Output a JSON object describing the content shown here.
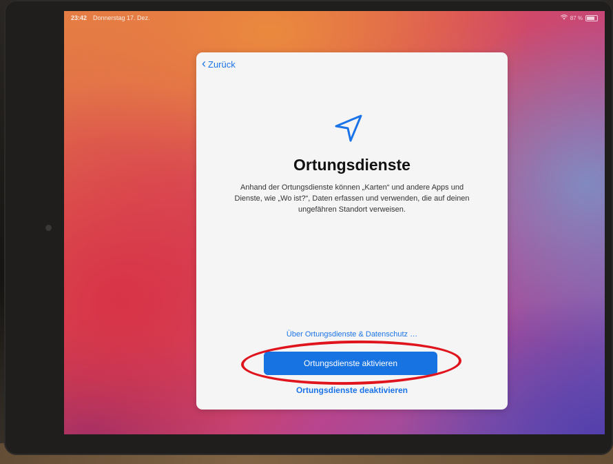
{
  "status_bar": {
    "time": "23:42",
    "date": "Donnerstag 17. Dez.",
    "battery": "87 %"
  },
  "sheet": {
    "back_label": "Zurück",
    "icon": "location-arrow-icon",
    "title": "Ortungsdienste",
    "description": "Anhand der Ortungsdienste können „Karten“ und andere Apps und Dienste, wie „Wo ist?“, Daten erfassen und verwenden, die auf deinen ungefähren Standort verweisen.",
    "privacy_link": "Über Ortungsdienste & Datenschutz …",
    "enable_button": "Ortungsdienste aktivieren",
    "disable_link": "Ortungsdienste deaktivieren"
  },
  "colors": {
    "accent": "#1773e2",
    "annotation": "#e0141c"
  }
}
